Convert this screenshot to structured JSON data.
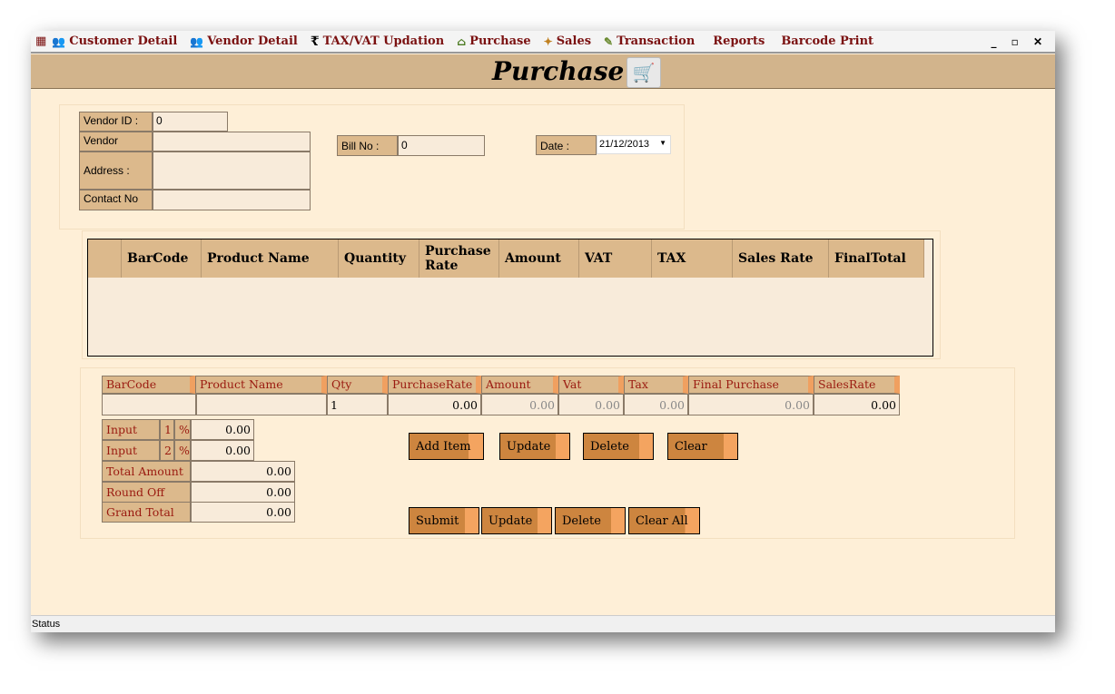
{
  "menu": [
    {
      "label": "Customer Detail",
      "icon": "users-icon"
    },
    {
      "label": "Vendor Detail",
      "icon": "users-icon"
    },
    {
      "label": "TAX/VAT Updation",
      "icon": "rupee-icon"
    },
    {
      "label": "Purchase",
      "icon": "basket-icon"
    },
    {
      "label": "Sales",
      "icon": "sales-icon"
    },
    {
      "label": "Transaction",
      "icon": "transaction-icon"
    },
    {
      "label": "Reports",
      "icon": ""
    },
    {
      "label": "Barcode Print",
      "icon": ""
    }
  ],
  "window_controls": "_ ▫ ✕",
  "header": {
    "title": "Purchase",
    "icon": "cart-icon"
  },
  "vendor": {
    "id_label": "Vendor ID :",
    "id_value": "0",
    "vendor_label": "Vendor",
    "vendor_value": "",
    "address_label": "Address :",
    "address_value": "",
    "contact_label": "Contact No",
    "contact_value": ""
  },
  "bill": {
    "label": "Bill No :",
    "value": "0"
  },
  "date": {
    "label": "Date :",
    "value": "21/12/2013"
  },
  "grid": {
    "columns": [
      "BarCode",
      "Product Name",
      "Quantity",
      "Purchase Rate",
      "Amount",
      "VAT",
      "TAX",
      "Sales Rate",
      "FinalTotal"
    ]
  },
  "entry": {
    "columns": [
      "BarCode",
      "Product Name",
      "Qty",
      "PurchaseRate",
      "Amount",
      "Vat",
      "Tax",
      "Final Purchase Rate",
      "SalesRate"
    ],
    "values": [
      "",
      "",
      "1",
      "0.00",
      "0.00",
      "0.00",
      "0.00",
      "0.00",
      "0.00"
    ]
  },
  "summary": {
    "input1_label": "Input",
    "input1_num": "1",
    "input1_pct": "%",
    "input1_value": "0.00",
    "input2_label": "Input",
    "input2_num": "2",
    "input2_pct": "%",
    "input2_value": "0.00",
    "total_label": "Total Amount",
    "total_value": "0.00",
    "round_label": "Round Off",
    "round_value": "0.00",
    "grand_label": "Grand Total",
    "grand_value": "0.00"
  },
  "item_buttons": [
    "Add Item",
    "Update",
    "Delete",
    "Clear"
  ],
  "form_buttons": [
    "Submit",
    "Update",
    "Delete",
    "Clear All"
  ],
  "status": "Status",
  "colors": {
    "header": "#d2b48c",
    "body": "#feefd7",
    "button": "#cd853f",
    "label_text": "#9a1a10"
  }
}
